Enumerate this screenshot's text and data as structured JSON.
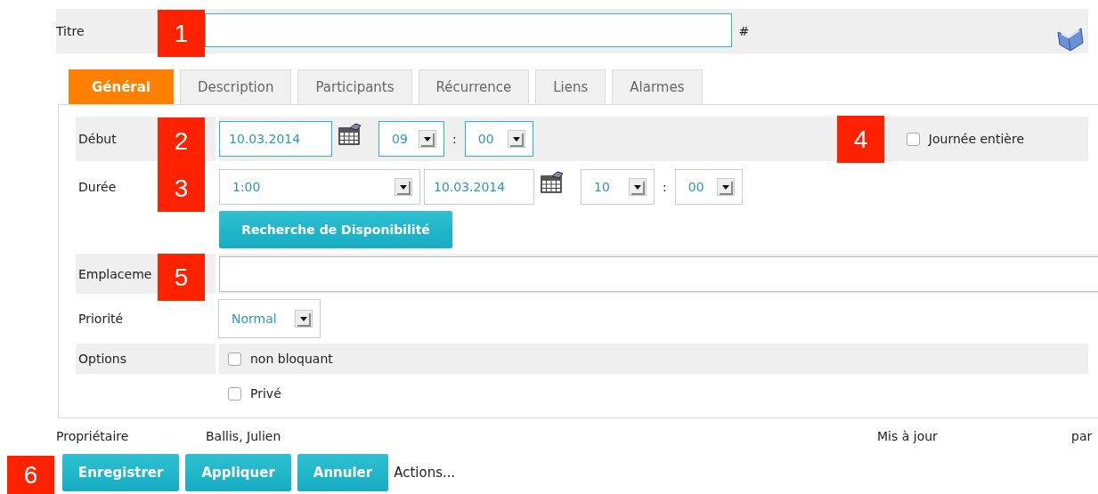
{
  "title_row": {
    "label": "Titre",
    "suffix": "#"
  },
  "tabs": [
    {
      "label": "Général",
      "selected": true
    },
    {
      "label": "Description",
      "selected": false
    },
    {
      "label": "Participants",
      "selected": false
    },
    {
      "label": "Récurrence",
      "selected": false
    },
    {
      "label": "Liens",
      "selected": false
    },
    {
      "label": "Alarmes",
      "selected": false
    }
  ],
  "start": {
    "label": "Début",
    "date": "10.03.2014",
    "hour": "09",
    "separator": ":",
    "minute": "00"
  },
  "all_day": {
    "label": "Journée entière",
    "checked": false
  },
  "duration": {
    "label": "Durée",
    "value": "1:00",
    "date": "10.03.2014",
    "hour": "10",
    "separator": ":",
    "minute": "00"
  },
  "availability_button": "Recherche de Disponibilité",
  "location": {
    "label": "Emplaceme"
  },
  "priority": {
    "label": "Priorité",
    "value": "Normal"
  },
  "options": {
    "label": "Options",
    "items": [
      {
        "label": "non bloquant",
        "checked": false
      },
      {
        "label": "Privé",
        "checked": false
      }
    ]
  },
  "footer": {
    "owner_label": "Propriétaire",
    "owner": "Ballis, Julien",
    "updated_label": "Mis à jour",
    "by_label": "par"
  },
  "buttons": [
    "Enregistrer",
    "Appliquer",
    "Annuler"
  ],
  "actions": "Actions...",
  "callouts": [
    "1",
    "2",
    "3",
    "4",
    "5",
    "6"
  ]
}
